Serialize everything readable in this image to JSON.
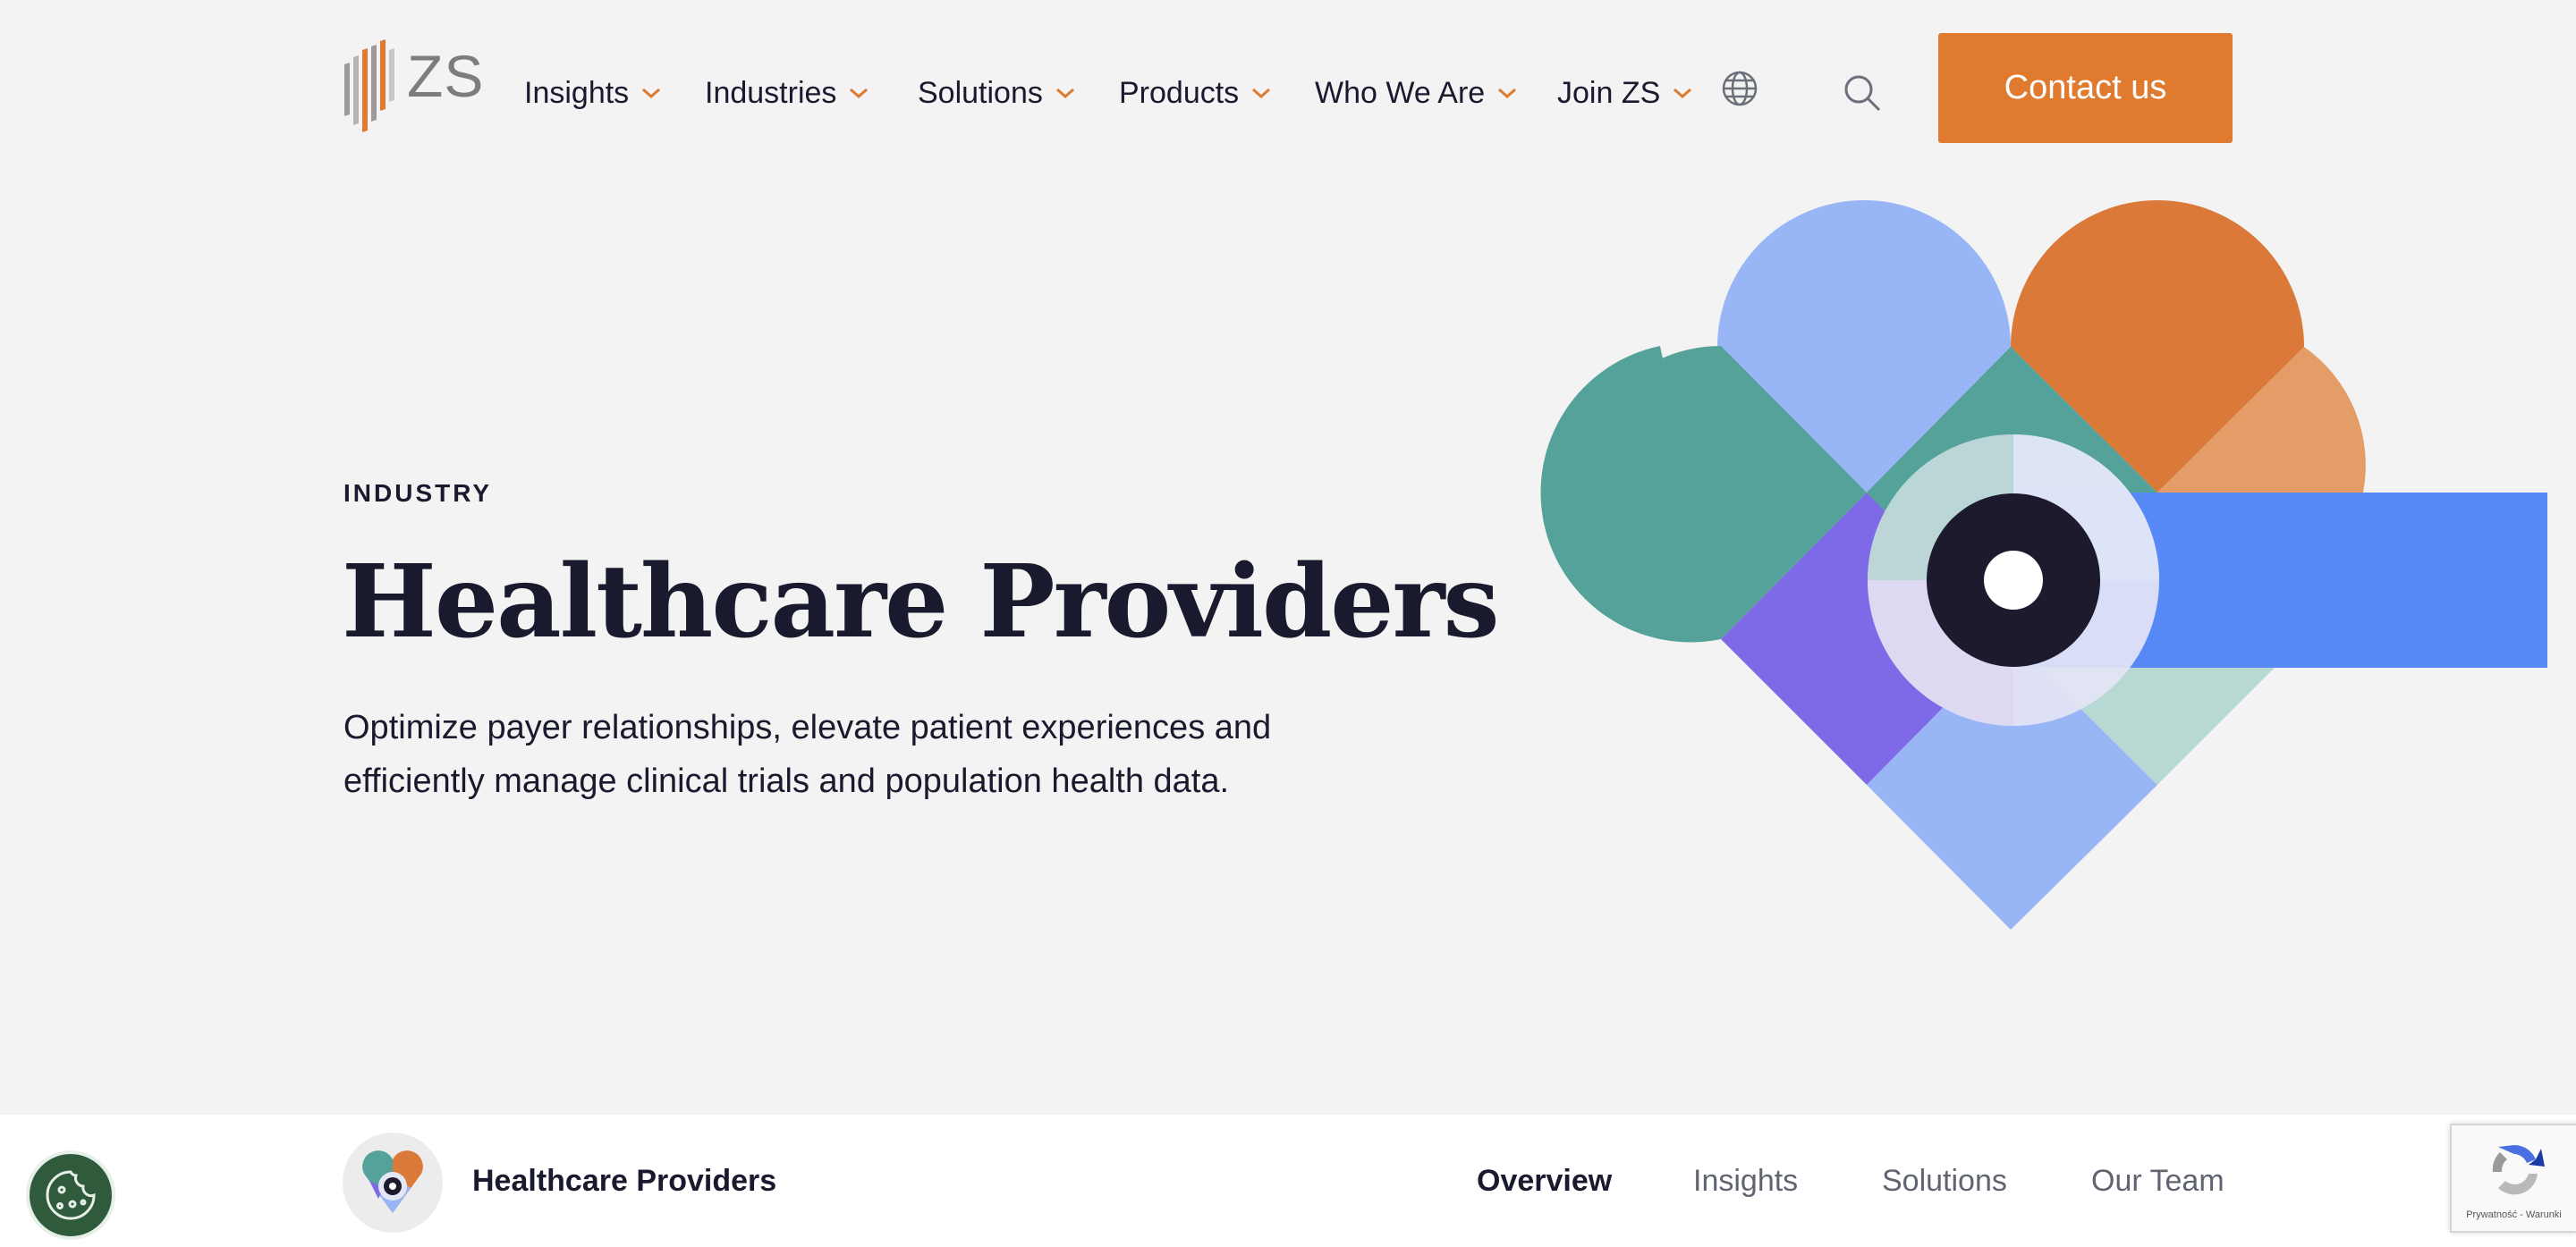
{
  "brand": {
    "logo_text": "ZS",
    "logo_icon": "zs-logo-icon"
  },
  "nav": {
    "items": [
      {
        "label": "Insights"
      },
      {
        "label": "Industries"
      },
      {
        "label": "Solutions"
      },
      {
        "label": "Products"
      },
      {
        "label": "Who We Are"
      },
      {
        "label": "Join ZS"
      }
    ],
    "globe_icon": "globe-icon",
    "search_icon": "search-icon",
    "contact_label": "Contact us"
  },
  "hero": {
    "eyebrow": "INDUSTRY",
    "title": "Healthcare Providers",
    "description_lines": [
      "Optimize payer relationships, elevate patient experiences and",
      "efficiently manage clinical trials and population health data."
    ],
    "illustration_icon": "heart-eye-illustration"
  },
  "subnav": {
    "title": "Healthcare Providers",
    "links": [
      {
        "label": "Overview",
        "active": true
      },
      {
        "label": "Insights",
        "active": false
      },
      {
        "label": "Solutions",
        "active": false
      },
      {
        "label": "Our Team",
        "active": false
      }
    ]
  },
  "widgets": {
    "cookie_icon": "cookie-icon",
    "recaptcha_text": "Prywatność - Warunki"
  },
  "colors": {
    "accent": "#e07a2e",
    "text": "#1a1a2e",
    "background": "#f3f3f3",
    "blue": "#5689f5",
    "light_blue": "#98b5f5",
    "teal": "#55a29a",
    "purple": "#7e69e6",
    "orange": "#db7a38",
    "cookie_green": "#2f5a3c"
  }
}
